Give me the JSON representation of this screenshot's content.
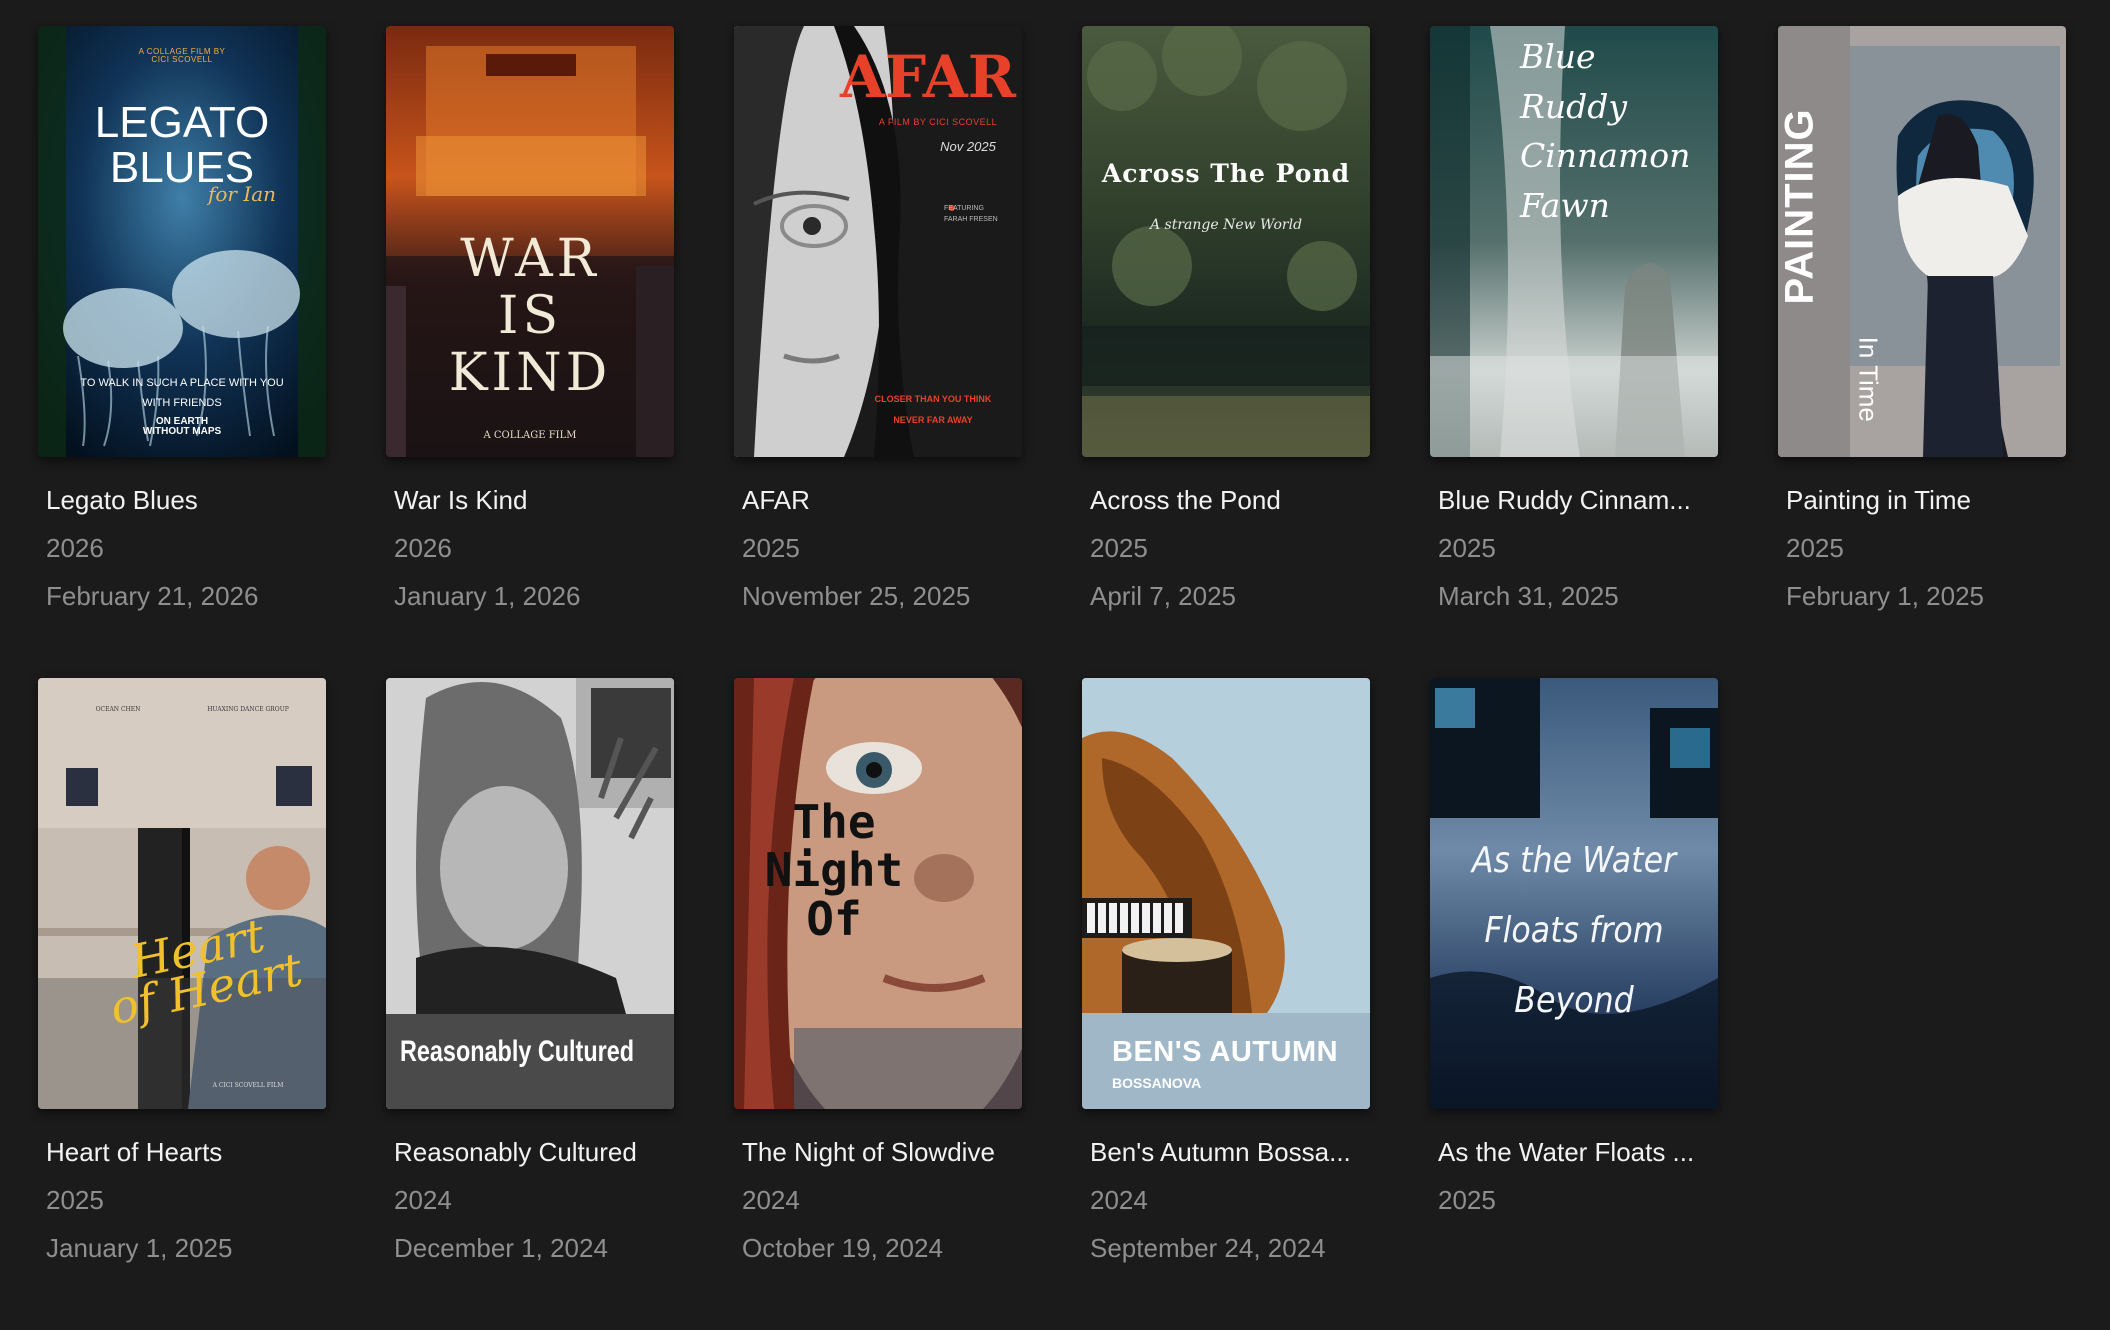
{
  "films": [
    {
      "title": "Legato Blues",
      "year": "2026",
      "date": "February 21, 2026",
      "poster": {
        "top": "A COLLAGE FILM BY\nCICI SCOVELL",
        "main": "LEGATO\nBLUES",
        "script": "for Ian",
        "tag1": "TO WALK IN SUCH A PLACE WITH YOU\nWITH FRIENDS",
        "tag2": "ON EARTH\nWITHOUT MAPS"
      }
    },
    {
      "title": "War Is Kind",
      "year": "2026",
      "date": "January 1, 2026",
      "poster": {
        "main": "WAR\nIS\nKIND",
        "credit": "A COLLAGE FILM"
      }
    },
    {
      "title": "AFAR",
      "year": "2025",
      "date": "November 25, 2025",
      "poster": {
        "main": "AFAR",
        "credit": "A FILM BY CICI SCOVELL",
        "date": "Nov 2025",
        "featuring": "FEATURING\nFARAH FRESEN",
        "tag": "CLOSER THAN YOU THINK\nNEVER FAR AWAY"
      }
    },
    {
      "title": "Across the Pond",
      "year": "2025",
      "date": "April 7, 2025",
      "poster": {
        "main": "Across The Pond",
        "sub": "A strange New World"
      }
    },
    {
      "title": "Blue Ruddy Cinnam...",
      "year": "2025",
      "date": "March 31, 2025",
      "poster": {
        "main": "Blue\nRuddy\nCinnamon\nFawn"
      }
    },
    {
      "title": "Painting in Time",
      "year": "2025",
      "date": "February 1, 2025",
      "poster": {
        "main": "PAINTING",
        "sub": "In Time"
      }
    },
    {
      "title": "Heart of Hearts",
      "year": "2025",
      "date": "January 1, 2025",
      "poster": {
        "left": "OCEAN CHEN",
        "right": "HUAXING DANCE GROUP",
        "main": "Heart\nof Heart",
        "credit": "A CICI SCOVELL FILM"
      }
    },
    {
      "title": "Reasonably Cultured",
      "year": "2024",
      "date": "December 1, 2024",
      "poster": {
        "main": "Reasonably Cultured"
      }
    },
    {
      "title": "The Night of Slowdive",
      "year": "2024",
      "date": "October 19, 2024",
      "poster": {
        "main": "The\nNight\nOf"
      }
    },
    {
      "title": "Ben's Autumn Bossa...",
      "year": "2024",
      "date": "September 24, 2024",
      "poster": {
        "main": "BEN'S AUTUMN",
        "sub": "BOSSANOVA"
      }
    },
    {
      "title": "As the Water Floats ...",
      "year": "2025",
      "date": "",
      "poster": {
        "main": "As the Water\nFloats from\nBeyond"
      }
    }
  ]
}
